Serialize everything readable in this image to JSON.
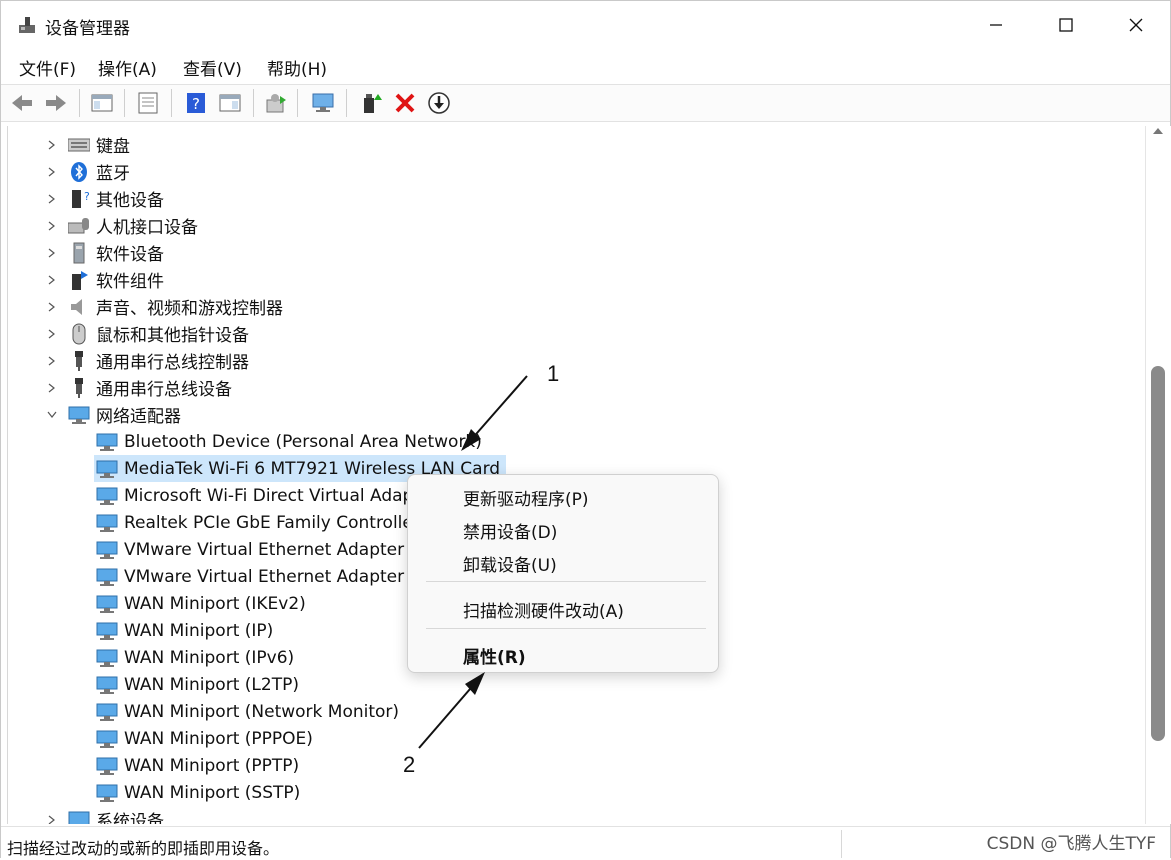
{
  "window": {
    "title": "设备管理器"
  },
  "menu": [
    "文件(F)",
    "操作(A)",
    "查看(V)",
    "帮助(H)"
  ],
  "toolbar": [
    "back-icon",
    "forward-icon",
    "show-hide-console-tree-icon",
    "properties-icon",
    "help-icon",
    "action-pane-icon",
    "scan-hardware-icon",
    "computer-icon",
    "enable-device-icon",
    "uninstall-icon",
    "update-driver-icon"
  ],
  "categories": [
    "键盘",
    "蓝牙",
    "其他设备",
    "人机接口设备",
    "软件设备",
    "软件组件",
    "声音、视频和游戏控制器",
    "鼠标和其他指针设备",
    "通用串行总线控制器",
    "通用串行总线设备",
    "网络适配器"
  ],
  "network_adapters": [
    "Bluetooth Device (Personal Area Network)",
    "MediaTek Wi-Fi 6 MT7921 Wireless LAN Card",
    "Microsoft Wi-Fi Direct Virtual Adap",
    "Realtek PCIe GbE Family Controlle",
    "VMware Virtual Ethernet Adapter f",
    "VMware Virtual Ethernet Adapter f",
    "WAN Miniport (IKEv2)",
    "WAN Miniport (IP)",
    "WAN Miniport (IPv6)",
    "WAN Miniport (L2TP)",
    "WAN Miniport (Network Monitor)",
    "WAN Miniport (PPPOE)",
    "WAN Miniport (PPTP)",
    "WAN Miniport (SSTP)"
  ],
  "next_category": "系统设备",
  "context_menu": {
    "update_driver": "更新驱动程序(P)",
    "disable": "禁用设备(D)",
    "uninstall": "卸载设备(U)",
    "scan": "扫描检测硬件改动(A)",
    "properties": "属性(R)"
  },
  "status": {
    "text": "扫描经过改动的或新的即插即用设备。",
    "watermark": "CSDN @飞腾人生TYF"
  },
  "annotations": {
    "one": "1",
    "two": "2"
  },
  "colors": {
    "selection": "#cde6fb",
    "accent": "#1a73e8"
  }
}
